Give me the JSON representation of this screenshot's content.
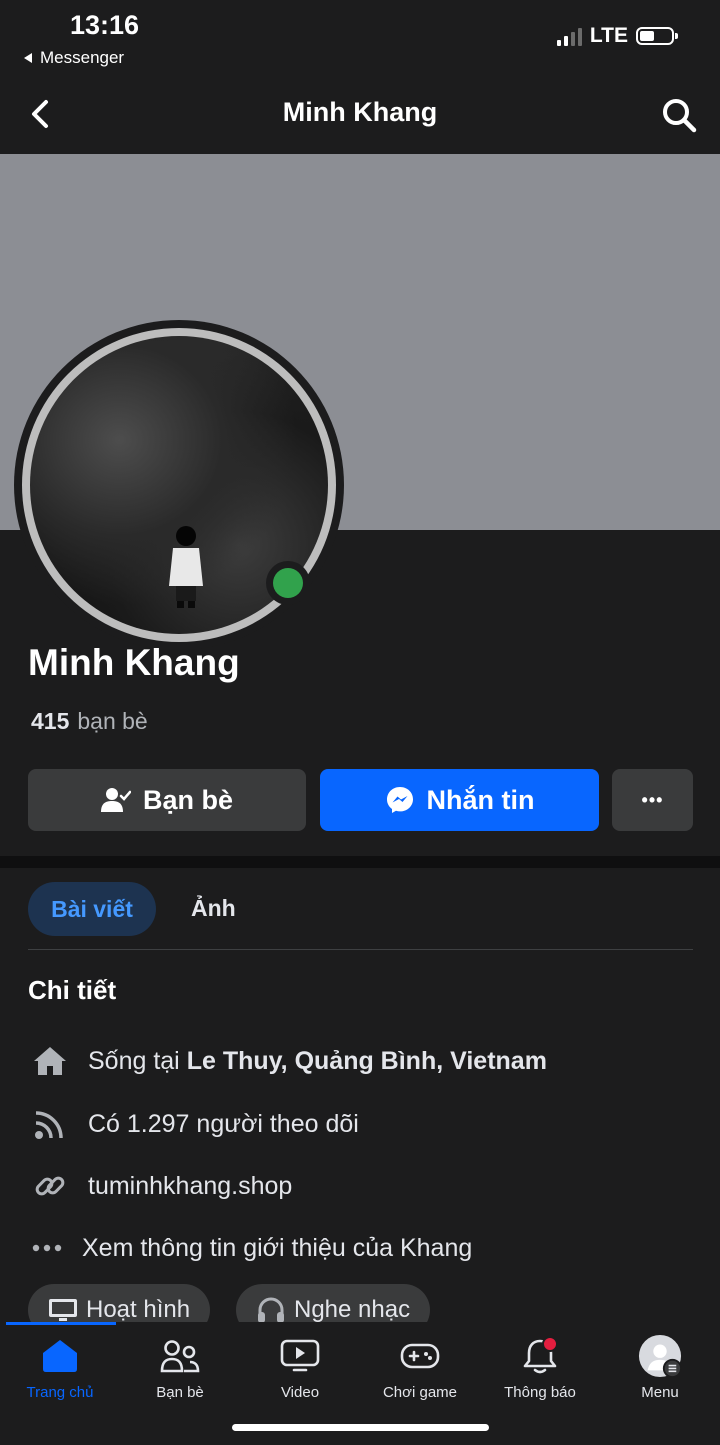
{
  "status_bar": {
    "time": "13:16",
    "back_app": "Messenger",
    "network": "LTE"
  },
  "header": {
    "title": "Minh Khang"
  },
  "profile": {
    "name": "Minh Khang",
    "friends_count": "415",
    "friends_label": "bạn bè",
    "online": true
  },
  "actions": {
    "friends_label": "Bạn bè",
    "message_label": "Nhắn tin",
    "more_label": "•••"
  },
  "tabs": {
    "posts": "Bài viết",
    "photos": "Ảnh"
  },
  "details": {
    "title": "Chi tiết",
    "lives_prefix": "Sống tại",
    "lives_location": "Le Thuy, Quảng Bình, Vietnam",
    "followers": "Có 1.297 người theo dõi",
    "website": "tuminhkhang.shop",
    "see_about": "Xem thông tin giới thiệu của Khang"
  },
  "interests": [
    {
      "label": "Hoạt hình",
      "icon": "tv-icon"
    },
    {
      "label": "Nghe nhạc",
      "icon": "headphones-icon"
    }
  ],
  "bottom_nav": [
    {
      "label": "Trang chủ",
      "icon": "home-icon",
      "active": true
    },
    {
      "label": "Bạn bè",
      "icon": "friends-icon"
    },
    {
      "label": "Video",
      "icon": "video-icon"
    },
    {
      "label": "Chơi game",
      "icon": "gaming-icon"
    },
    {
      "label": "Thông báo",
      "icon": "bell-icon"
    },
    {
      "label": "Menu",
      "icon": "profile-menu-icon"
    }
  ],
  "colors": {
    "accent": "#0866ff",
    "background": "#1c1c1d",
    "online": "#31a24c",
    "cover": "#8c8e94"
  }
}
